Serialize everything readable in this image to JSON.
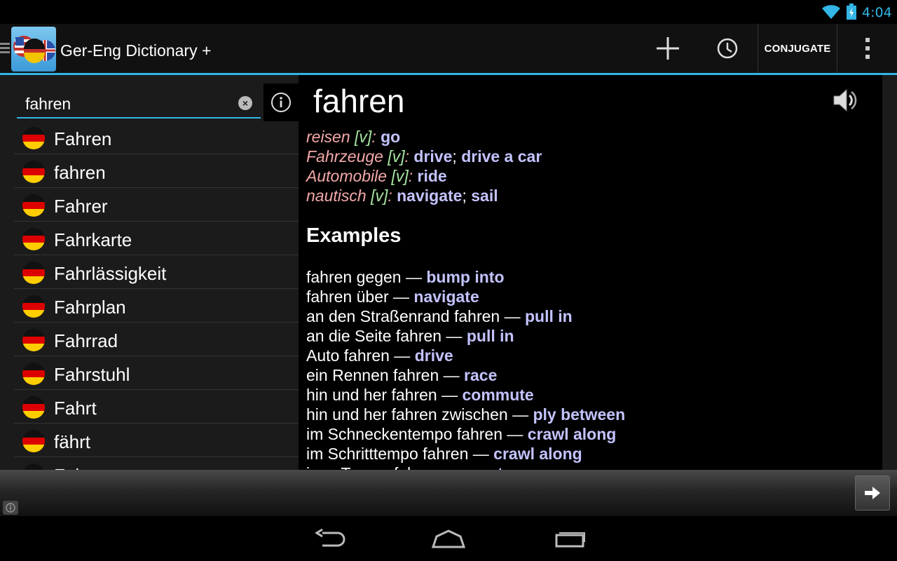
{
  "status_bar": {
    "time": "4:04"
  },
  "action_bar": {
    "title": "Ger-Eng Dictionary +",
    "conjugate_label": "CONJUGATE"
  },
  "search": {
    "value": "fahren"
  },
  "word_list": [
    "Fahren",
    "fahren",
    "Fahrer",
    "Fahrkarte",
    "Fahrlässigkeit",
    "Fahrplan",
    "Fahrrad",
    "Fahrstuhl",
    "Fahrt",
    "fährt",
    "Fahrzeug"
  ],
  "entry": {
    "headword": "fahren",
    "definitions": [
      {
        "context": "reisen",
        "pos": "[v]",
        "translations": [
          "go"
        ]
      },
      {
        "context": "Fahrzeuge",
        "pos": "[v]",
        "translations": [
          "drive",
          "drive a car"
        ]
      },
      {
        "context": "Automobile",
        "pos": "[v]",
        "translations": [
          "ride"
        ]
      },
      {
        "context": "nautisch",
        "pos": "[v]",
        "translations": [
          "navigate",
          "sail"
        ]
      }
    ],
    "examples_title": "Examples",
    "examples": [
      {
        "de": "fahren gegen",
        "en": "bump into"
      },
      {
        "de": "fahren über",
        "en": "navigate"
      },
      {
        "de": "an den Straßenrand fahren",
        "en": "pull in"
      },
      {
        "de": "an die Seite fahren",
        "en": "pull in"
      },
      {
        "de": "Auto fahren",
        "en": "drive"
      },
      {
        "de": "ein Rennen fahren",
        "en": "race"
      },
      {
        "de": "hin und her fahren",
        "en": "commute"
      },
      {
        "de": "hin und her fahren zwischen",
        "en": "ply between"
      },
      {
        "de": "im Schneckentempo fahren",
        "en": "crawl along"
      },
      {
        "de": "im Schritttempo fahren",
        "en": "crawl along"
      },
      {
        "de": "in ... Tempo fahren",
        "en": "go at"
      }
    ]
  },
  "icons": {
    "flag": "german-flag-icon",
    "speaker": "speaker-icon",
    "add": "plus-icon",
    "history": "clock-icon",
    "overflow": "overflow-menu-icon"
  },
  "colors": {
    "accent": "#33b5e5",
    "context": "#f4a9a9",
    "pos": "#a6e6a0",
    "translation": "#c3c3ff"
  }
}
